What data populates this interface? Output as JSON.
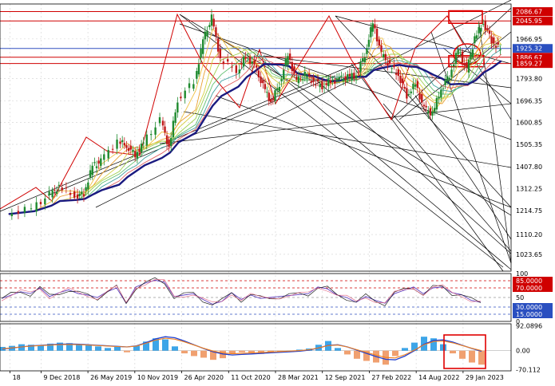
{
  "chart_data": [
    {
      "id": "price",
      "type": "candlestick",
      "title": "",
      "y_ticks": [
        "1023.65",
        "1110.20",
        "1214.75",
        "1312.25",
        "1407.80",
        "1505.35",
        "1600.85",
        "1696.35",
        "1793.80",
        "1966.95",
        "2086.67"
      ],
      "price_axis_extra_labels": [
        "2086.67",
        "2045.95",
        "1925.32",
        "1886.67",
        "1859.27"
      ],
      "horizontal_levels": [
        {
          "value": 2086.67,
          "color": "#d00000"
        },
        {
          "value": 2045.95,
          "color": "#d00000"
        },
        {
          "value": 1925.32,
          "color": "#3050c0"
        },
        {
          "value": 1886.67,
          "color": "#d00000"
        },
        {
          "value": 1859.27,
          "color": "#d00000"
        }
      ],
      "x_ticks": [
        "18",
        "9 Dec 2018",
        "26 May 2019",
        "10 Nov 2019",
        "26 Apr 2020",
        "11 Oct 2020",
        "28 Mar 2021",
        "12 Sep 2021",
        "27 Feb 2022",
        "14 Aug 2022",
        "29 Jan 2023"
      ],
      "ylim": [
        950,
        2120
      ],
      "close_series": [
        {
          "date": "2018-08",
          "close": 1200
        },
        {
          "date": "2018-11",
          "close": 1225
        },
        {
          "date": "2019-01",
          "close": 1285
        },
        {
          "date": "2019-02",
          "close": 1320
        },
        {
          "date": "2019-04",
          "close": 1280
        },
        {
          "date": "2019-05",
          "close": 1290
        },
        {
          "date": "2019-06",
          "close": 1410
        },
        {
          "date": "2019-07",
          "close": 1430
        },
        {
          "date": "2019-09",
          "close": 1520
        },
        {
          "date": "2019-10",
          "close": 1500
        },
        {
          "date": "2019-11",
          "close": 1460
        },
        {
          "date": "2019-12",
          "close": 1510
        },
        {
          "date": "2020-02",
          "close": 1610
        },
        {
          "date": "2020-03",
          "close": 1490
        },
        {
          "date": "2020-04",
          "close": 1700
        },
        {
          "date": "2020-06",
          "close": 1780
        },
        {
          "date": "2020-07",
          "close": 1960
        },
        {
          "date": "2020-08",
          "close": 2060
        },
        {
          "date": "2020-09",
          "close": 1880
        },
        {
          "date": "2020-11",
          "close": 1830
        },
        {
          "date": "2020-12",
          "close": 1890
        },
        {
          "date": "2021-01",
          "close": 1850
        },
        {
          "date": "2021-02",
          "close": 1760
        },
        {
          "date": "2021-03",
          "close": 1690
        },
        {
          "date": "2021-04",
          "close": 1770
        },
        {
          "date": "2021-05",
          "close": 1900
        },
        {
          "date": "2021-06",
          "close": 1780
        },
        {
          "date": "2021-07",
          "close": 1810
        },
        {
          "date": "2021-08",
          "close": 1780
        },
        {
          "date": "2021-09",
          "close": 1760
        },
        {
          "date": "2021-10",
          "close": 1780
        },
        {
          "date": "2021-11",
          "close": 1790
        },
        {
          "date": "2021-12",
          "close": 1800
        },
        {
          "date": "2022-01",
          "close": 1810
        },
        {
          "date": "2022-02",
          "close": 1900
        },
        {
          "date": "2022-03",
          "close": 2040
        },
        {
          "date": "2022-04",
          "close": 1900
        },
        {
          "date": "2022-05",
          "close": 1850
        },
        {
          "date": "2022-06",
          "close": 1810
        },
        {
          "date": "2022-07",
          "close": 1720
        },
        {
          "date": "2022-08",
          "close": 1770
        },
        {
          "date": "2022-09",
          "close": 1660
        },
        {
          "date": "2022-10",
          "close": 1640
        },
        {
          "date": "2022-11",
          "close": 1750
        },
        {
          "date": "2022-12",
          "close": 1810
        },
        {
          "date": "2023-01",
          "close": 1920
        },
        {
          "date": "2023-02",
          "close": 1830
        },
        {
          "date": "2023-03",
          "close": 1970
        },
        {
          "date": "2023-04",
          "close": 2040
        },
        {
          "date": "2023-05",
          "close": 1960
        },
        {
          "date": "2023-06",
          "close": 1920
        }
      ]
    },
    {
      "id": "rsi",
      "type": "line",
      "title": "",
      "y_ticks": [
        "100",
        "85.0000",
        "70.0000",
        "50",
        "30.0000",
        "15.0000",
        "0"
      ],
      "ylim": [
        0,
        100
      ],
      "levels": [
        85,
        70,
        50,
        30,
        15
      ],
      "values": [
        48,
        55,
        62,
        58,
        70,
        52,
        60,
        66,
        58,
        55,
        50,
        62,
        70,
        38,
        72,
        80,
        86,
        82,
        52,
        55,
        58,
        46,
        36,
        42,
        60,
        46,
        55,
        48,
        50,
        52,
        54,
        56,
        58,
        72,
        68,
        55,
        50,
        40,
        52,
        44,
        38,
        58,
        65,
        72,
        58,
        70,
        72,
        60,
        56,
        44,
        40
      ]
    },
    {
      "id": "macd",
      "type": "bar+line",
      "title": "",
      "y_ticks": [
        "92.0896",
        "0.00",
        "-70.112"
      ],
      "ylim": [
        -75,
        100
      ],
      "histogram": [
        14,
        18,
        24,
        22,
        20,
        26,
        30,
        28,
        24,
        20,
        16,
        10,
        14,
        -6,
        18,
        34,
        46,
        42,
        16,
        -10,
        -20,
        -26,
        -34,
        -28,
        -10,
        -6,
        -10,
        -12,
        -8,
        -4,
        0,
        4,
        8,
        22,
        36,
        10,
        -14,
        -30,
        -38,
        -44,
        -52,
        -20,
        10,
        30,
        52,
        46,
        24,
        -10,
        -30,
        -44,
        -52
      ],
      "signal": [
        6,
        10,
        14,
        18,
        20,
        22,
        24,
        25,
        24,
        22,
        20,
        18,
        16,
        14,
        18,
        30,
        44,
        52,
        48,
        36,
        22,
        8,
        -4,
        -12,
        -16,
        -14,
        -12,
        -10,
        -8,
        -6,
        -4,
        -2,
        2,
        10,
        20,
        22,
        14,
        2,
        -10,
        -22,
        -32,
        -34,
        -20,
        0,
        24,
        38,
        40,
        32,
        20,
        8,
        -2
      ]
    }
  ]
}
